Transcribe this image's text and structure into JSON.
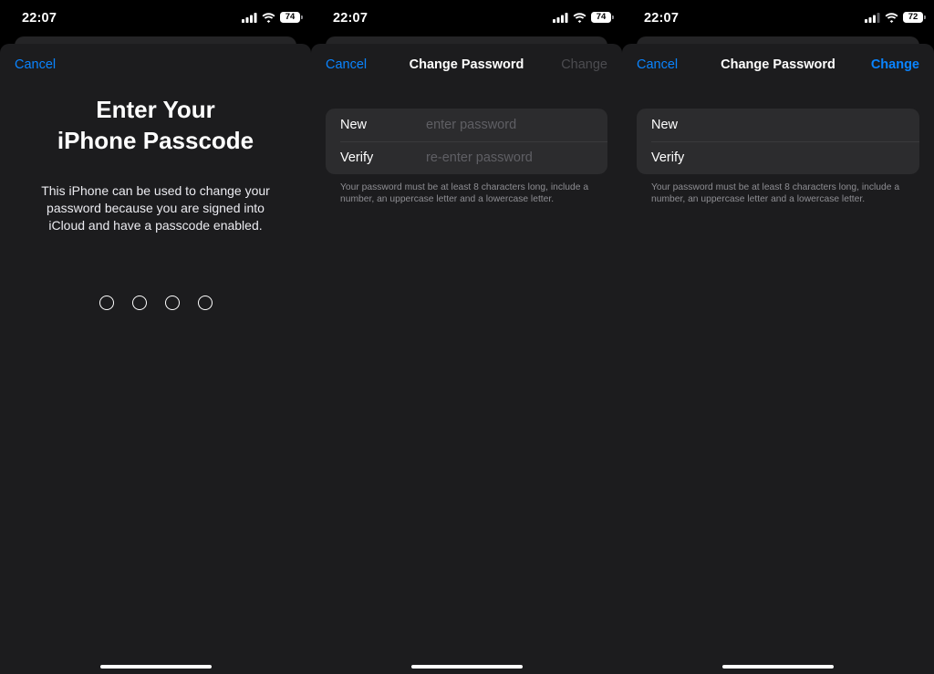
{
  "screens": [
    {
      "status": {
        "time": "22:07",
        "battery": "74"
      },
      "nav": {
        "cancel": "Cancel"
      },
      "heading_line1": "Enter Your",
      "heading_line2": "iPhone Passcode",
      "description": "This iPhone can be used to change your password because you are signed into iCloud and have a passcode enabled.",
      "passcode_digits": 4
    },
    {
      "status": {
        "time": "22:07",
        "battery": "74"
      },
      "nav": {
        "cancel": "Cancel",
        "title": "Change Password",
        "change": "Change",
        "change_enabled": false
      },
      "fields": [
        {
          "label": "New",
          "placeholder": "enter password"
        },
        {
          "label": "Verify",
          "placeholder": "re-enter password"
        }
      ],
      "hint": "Your password must be at least 8 characters long, include a number, an uppercase letter and a lowercase letter."
    },
    {
      "status": {
        "time": "22:07",
        "battery": "72"
      },
      "nav": {
        "cancel": "Cancel",
        "title": "Change Password",
        "change": "Change",
        "change_enabled": true
      },
      "fields": [
        {
          "label": "New",
          "placeholder": ""
        },
        {
          "label": "Verify",
          "placeholder": ""
        }
      ],
      "hint": "Your password must be at least 8 characters long, include a number, an uppercase letter and a lowercase letter."
    }
  ],
  "icons": [
    "cellular-signal-icon",
    "wifi-icon",
    "battery-icon"
  ],
  "colors": {
    "accent": "#0a84ff",
    "sheet": "#1c1c1e",
    "cell": "#2c2c2e",
    "disabled": "#4c4c50",
    "hint": "#8e8e93"
  }
}
